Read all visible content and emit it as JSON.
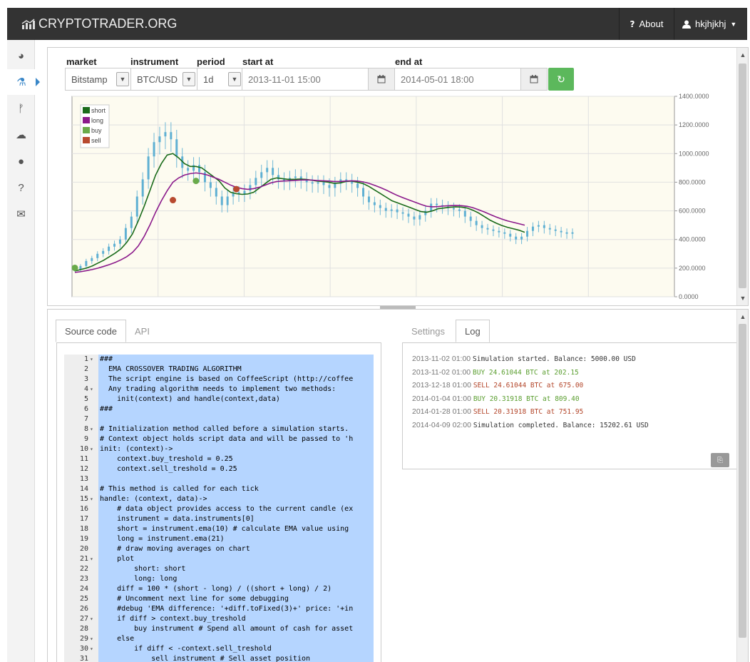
{
  "navbar": {
    "brand": "CRYPTOTRADER.ORG",
    "about": "About",
    "about_icon": "?",
    "user": "hkjhjkhj"
  },
  "sidebar": {
    "items": [
      {
        "name": "dashboard-icon",
        "glyph": "◕"
      },
      {
        "name": "lab-flask-icon",
        "glyph": "⚗",
        "active": true
      },
      {
        "name": "fork-icon",
        "glyph": "ᚠ"
      },
      {
        "name": "cloud-icon",
        "glyph": "☁"
      },
      {
        "name": "chat-bubble-icon",
        "glyph": "●"
      },
      {
        "name": "help-icon",
        "glyph": "?"
      },
      {
        "name": "envelope-icon",
        "glyph": "✉"
      }
    ]
  },
  "controls": {
    "labels": {
      "market": "market",
      "instrument": "instrument",
      "period": "period",
      "start": "start at",
      "end": "end at"
    },
    "market": "Bitstamp",
    "instrument": "BTC/USD",
    "period": "1d",
    "start_at": "2013-11-01 15:00",
    "end_at": "2014-05-01 18:00"
  },
  "chart_data": {
    "type": "line",
    "x_label": "",
    "y_label": "",
    "ylim": [
      0,
      1400
    ],
    "y_ticks": [
      "1400.0000",
      "1200.0000",
      "1000.0000",
      "800.0000",
      "600.0000",
      "400.0000",
      "200.0000",
      "0.0000"
    ],
    "grid": true,
    "legend_position": "top-left",
    "legend": [
      {
        "name": "short",
        "color": "#1a6b1a"
      },
      {
        "name": "long",
        "color": "#8b1a8b"
      },
      {
        "name": "buy",
        "color": "#6aaa4a"
      },
      {
        "name": "sell",
        "color": "#b84a30"
      }
    ],
    "price": [
      190,
      215,
      250,
      270,
      300,
      320,
      350,
      370,
      400,
      480,
      560,
      700,
      820,
      980,
      1080,
      1120,
      1150,
      1100,
      980,
      900,
      880,
      920,
      870,
      800,
      760,
      700,
      640,
      700,
      730,
      720,
      740,
      780,
      830,
      870,
      900,
      850,
      820,
      810,
      830,
      840,
      820,
      800,
      790,
      800,
      780,
      760,
      790,
      820,
      810,
      790,
      760,
      700,
      660,
      640,
      620,
      600,
      610,
      590,
      580,
      560,
      540,
      570,
      600,
      650,
      640,
      630,
      620,
      610,
      600,
      560,
      530,
      500,
      480,
      470,
      460,
      450,
      440,
      420,
      400,
      420,
      460,
      490,
      500,
      480,
      470,
      460,
      450,
      440,
      450
    ],
    "series": [
      {
        "name": "short",
        "values": [
          180,
          190,
          200,
          215,
          235,
          255,
          280,
          305,
          335,
          380,
          440,
          530,
          630,
          740,
          850,
          930,
          990,
          1000,
          970,
          930,
          910,
          910,
          900,
          870,
          840,
          810,
          760,
          730,
          720,
          715,
          718,
          730,
          760,
          790,
          820,
          830,
          825,
          820,
          820,
          822,
          820,
          815,
          808,
          805,
          800,
          792,
          795,
          805,
          808,
          800,
          790,
          770,
          745,
          720,
          695,
          670,
          655,
          640,
          625,
          610,
          595,
          590,
          600,
          615,
          620,
          625,
          628,
          626,
          620,
          605,
          585,
          560,
          535,
          515,
          498,
          485,
          475,
          465,
          450
        ]
      },
      {
        "name": "long",
        "values": [
          170,
          175,
          182,
          190,
          200,
          212,
          225,
          240,
          258,
          280,
          310,
          355,
          420,
          500,
          590,
          670,
          740,
          800,
          830,
          850,
          860,
          865,
          860,
          850,
          835,
          820,
          800,
          780,
          765,
          755,
          750,
          755,
          765,
          780,
          795,
          805,
          808,
          810,
          812,
          815,
          816,
          815,
          812,
          810,
          808,
          805,
          805,
          808,
          810,
          808,
          802,
          792,
          778,
          762,
          745,
          725,
          706,
          690,
          675,
          660,
          645,
          632,
          628,
          630,
          634,
          636,
          638,
          636,
          632,
          622,
          608,
          592,
          575,
          558,
          543,
          530,
          520,
          510,
          500
        ]
      }
    ],
    "trades": [
      {
        "type": "buy",
        "index": 0,
        "value": 202
      },
      {
        "type": "sell",
        "index": 17,
        "value": 675
      },
      {
        "type": "buy",
        "index": 21,
        "value": 809
      },
      {
        "type": "sell",
        "index": 28,
        "value": 752
      }
    ]
  },
  "tabs_left": [
    {
      "label": "Source code",
      "active": true
    },
    {
      "label": "API",
      "active": false
    }
  ],
  "tabs_right": [
    {
      "label": "Settings",
      "active": false
    },
    {
      "label": "Log",
      "active": true
    }
  ],
  "code": [
    {
      "n": "1",
      "f": "▾",
      "t": "###",
      "c": "comment"
    },
    {
      "n": "2",
      "f": "",
      "t": "  EMA CROSSOVER TRADING ALGORITHM",
      "c": "comment"
    },
    {
      "n": "3",
      "f": "",
      "t": "  The script engine is based on CoffeeScript (http://coffee",
      "c": "comment"
    },
    {
      "n": "4",
      "f": "▾",
      "t": "  Any trading algorithm needs to implement two methods:",
      "c": "comment"
    },
    {
      "n": "5",
      "f": "",
      "t": "    init(context) and handle(context,data)",
      "c": "comment"
    },
    {
      "n": "6",
      "f": "",
      "t": "###",
      "c": "comment"
    },
    {
      "n": "7",
      "f": "",
      "t": "",
      "c": ""
    },
    {
      "n": "8",
      "f": "▾",
      "t": "# Initialization method called before a simulation starts.",
      "c": "comment"
    },
    {
      "n": "9",
      "f": "",
      "t": "# Context object holds script data and will be passed to 'h",
      "c": "comment"
    },
    {
      "n": "10",
      "f": "▾",
      "t": "init: (context)->",
      "c": "key"
    },
    {
      "n": "11",
      "f": "",
      "t": "    context.buy_treshold = 0.25",
      "c": ""
    },
    {
      "n": "12",
      "f": "",
      "t": "    context.sell_treshold = 0.25",
      "c": ""
    },
    {
      "n": "13",
      "f": "",
      "t": "",
      "c": ""
    },
    {
      "n": "14",
      "f": "",
      "t": "# This method is called for each tick",
      "c": "comment"
    },
    {
      "n": "15",
      "f": "▾",
      "t": "handle: (context, data)->",
      "c": "key"
    },
    {
      "n": "16",
      "f": "",
      "t": "    # data object provides access to the current candle (ex",
      "c": "comment"
    },
    {
      "n": "17",
      "f": "",
      "t": "    instrument = data.instruments[0]",
      "c": ""
    },
    {
      "n": "18",
      "f": "",
      "t": "    short = instrument.ema(10) # calculate EMA value using",
      "c": ""
    },
    {
      "n": "19",
      "f": "",
      "t": "    long = instrument.ema(21)",
      "c": ""
    },
    {
      "n": "20",
      "f": "",
      "t": "    # draw moving averages on chart",
      "c": "comment"
    },
    {
      "n": "21",
      "f": "▾",
      "t": "    plot",
      "c": ""
    },
    {
      "n": "22",
      "f": "",
      "t": "        short: short",
      "c": ""
    },
    {
      "n": "23",
      "f": "",
      "t": "        long: long",
      "c": ""
    },
    {
      "n": "24",
      "f": "",
      "t": "    diff = 100 * (short - long) / ((short + long) / 2)",
      "c": ""
    },
    {
      "n": "25",
      "f": "",
      "t": "    # Uncomment next line for some debugging",
      "c": "comment"
    },
    {
      "n": "26",
      "f": "",
      "t": "    #debug 'EMA difference: '+diff.toFixed(3)+' price: '+in",
      "c": "comment"
    },
    {
      "n": "27",
      "f": "▾",
      "t": "    if diff > context.buy_treshold",
      "c": ""
    },
    {
      "n": "28",
      "f": "",
      "t": "        buy instrument # Spend all amount of cash for asset",
      "c": ""
    },
    {
      "n": "29",
      "f": "▾",
      "t": "    else",
      "c": ""
    },
    {
      "n": "30",
      "f": "▾",
      "t": "        if diff < -context.sell_treshold",
      "c": ""
    },
    {
      "n": "31",
      "f": "",
      "t": "            sell instrument # Sell asset position",
      "c": ""
    }
  ],
  "log": [
    {
      "ts": "2013-11-02 01:00",
      "msg": "Simulation started. Balance: 5000.00 USD",
      "kind": "info"
    },
    {
      "ts": "2013-11-02 01:00",
      "msg": "BUY 24.61044 BTC at 202.15",
      "kind": "buy"
    },
    {
      "ts": "2013-12-18 01:00",
      "msg": "SELL 24.61044 BTC at 675.00",
      "kind": "sell"
    },
    {
      "ts": "2014-01-04 01:00",
      "msg": "BUY 20.31918 BTC at 809.40",
      "kind": "buy"
    },
    {
      "ts": "2014-01-28 01:00",
      "msg": "SELL 20.31918 BTC at 751.95",
      "kind": "sell"
    },
    {
      "ts": "2014-04-09 02:00",
      "msg": "Simulation completed. Balance: 15202.61 USD",
      "kind": "info"
    }
  ]
}
